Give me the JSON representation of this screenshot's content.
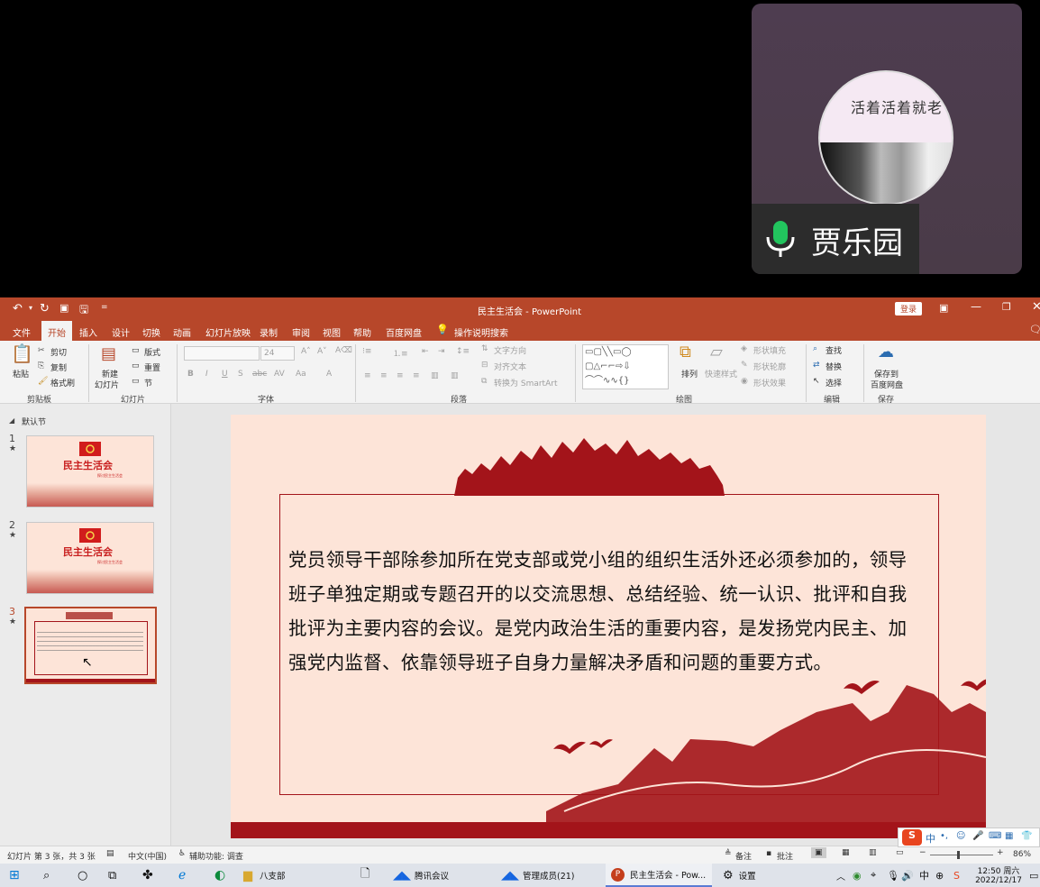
{
  "meeting": {
    "participant_name": "贾乐园",
    "avatar_text": "活着活着就老"
  },
  "ppt": {
    "window_title": "民主生活会 - PowerPoint",
    "login_button": "登录",
    "tabs": [
      "文件",
      "开始",
      "插入",
      "设计",
      "切换",
      "动画",
      "幻灯片放映",
      "录制",
      "审阅",
      "视图",
      "帮助",
      "百度网盘",
      "操作说明搜索"
    ],
    "active_tab": "开始",
    "ribbon": {
      "clipboard": {
        "paste": "粘贴",
        "cut": "剪切",
        "copy": "复制",
        "format_painter": "格式刷",
        "label": "剪贴板"
      },
      "slides": {
        "new_slide_line1": "新建",
        "new_slide_line2": "幻灯片",
        "layout": "版式",
        "reset": "重置",
        "section": "节",
        "label": "幻灯片"
      },
      "font": {
        "size": "24",
        "label": "字体"
      },
      "paragraph": {
        "text_direction": "文字方向",
        "align_text": "对齐文本",
        "convert_smartart": "转换为 SmartArt",
        "label": "段落"
      },
      "drawing": {
        "arrange": "排列",
        "quick_styles": "快速样式",
        "shape_fill": "形状填充",
        "shape_outline": "形状轮廓",
        "shape_effects": "形状效果",
        "label": "绘图"
      },
      "editing": {
        "find": "查找",
        "replace": "替换",
        "select": "选择",
        "label": "编辑"
      },
      "save": {
        "line1": "保存到",
        "line2": "百度网盘",
        "label": "保存"
      }
    },
    "thumbnails": {
      "section_name": "默认节",
      "items": [
        {
          "number": "1",
          "title": "民主生活会",
          "sub": "探讨民主生活会"
        },
        {
          "number": "2",
          "title": "民主生活会",
          "sub": "探讨民主生活会"
        },
        {
          "number": "3",
          "title": "",
          "sub": ""
        }
      ]
    },
    "slide": {
      "body": "党员领导干部除参加所在党支部或党小组的组织生活外还必须参加的，领导班子单独定期或专题召开的以交流思想、总结经验、统一认识、批评和自我批评为主要内容的会议。是党内政治生活的重要内容，是发扬党内民主、加强党内监督、依靠领导班子自身力量解决矛盾和问题的重要方式。"
    },
    "status": {
      "slide_count": "幻灯片 第 3 张，共 3 张",
      "language": "中文(中国)",
      "accessibility": "辅助功能: 调查",
      "notes": "备注",
      "comments": "批注",
      "zoom": "86%"
    }
  },
  "taskbar": {
    "items": [
      "八支部",
      "腾讯会议",
      "管理成员(21)",
      "民主生活会 - Pow...",
      "设置"
    ],
    "time": "12:50 周六",
    "date": "2022/12/17",
    "ime": "中"
  },
  "colors": {
    "ppt_red": "#b7472a",
    "slide_bg": "#fde4d8",
    "slide_red": "#a3141a"
  }
}
